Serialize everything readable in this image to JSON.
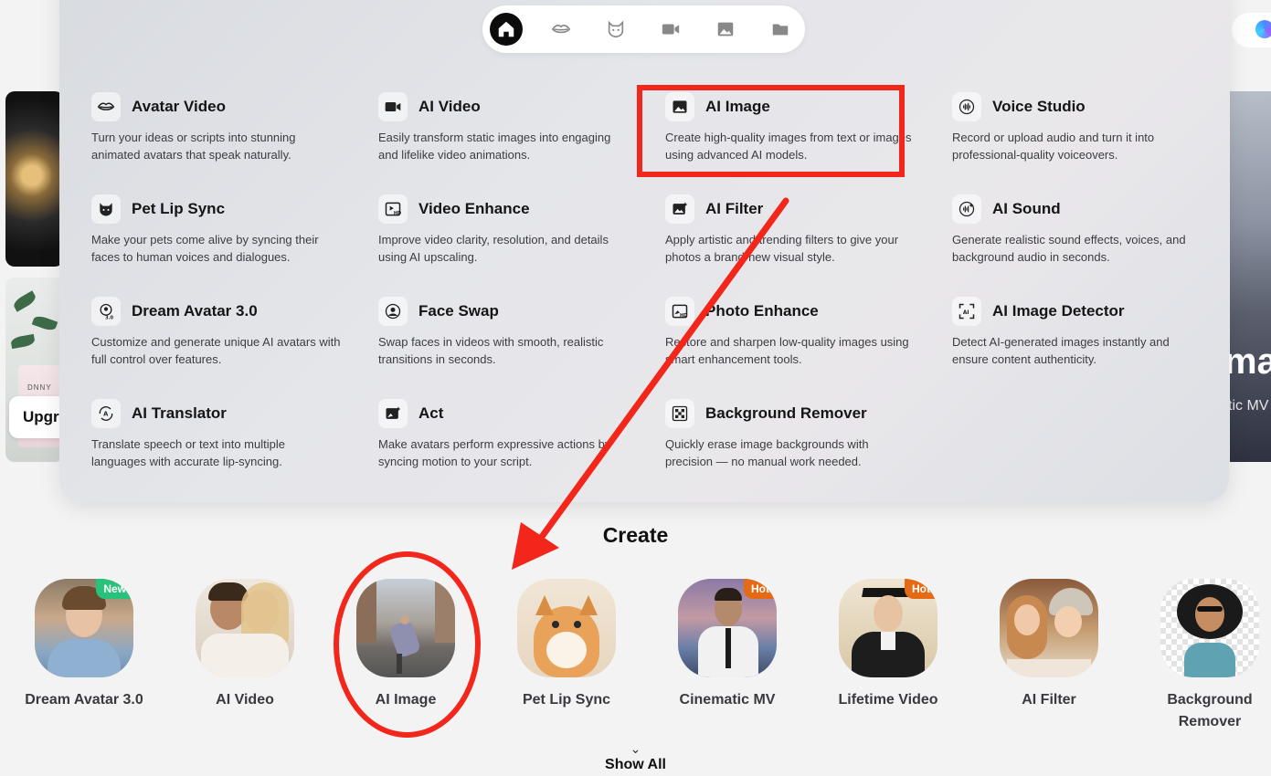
{
  "background": {
    "upgrade_label": "Upgr",
    "bottle_label": "DNNY",
    "right_title": "ma",
    "right_subtitle": "tic MV"
  },
  "nav_tabs": [
    {
      "icon": "home-icon",
      "active": true
    },
    {
      "icon": "lips-icon",
      "active": false
    },
    {
      "icon": "cat-icon",
      "active": false
    },
    {
      "icon": "video-camera-icon",
      "active": false
    },
    {
      "icon": "image-icon",
      "active": false
    },
    {
      "icon": "folder-icon",
      "active": false
    }
  ],
  "menu": [
    {
      "title": "Avatar Video",
      "desc": "Turn your ideas or scripts into stunning animated avatars that speak naturally.",
      "icon": "lips-icon"
    },
    {
      "title": "AI Video",
      "desc": "Easily transform static images into engaging and lifelike video animations.",
      "icon": "video-camera-icon"
    },
    {
      "title": "AI Image",
      "desc": "Create high-quality images from text or images using advanced AI models.",
      "icon": "image-icon"
    },
    {
      "title": "Voice Studio",
      "desc": "Record or upload audio and turn it into professional-quality voiceovers.",
      "icon": "voice-wave-icon"
    },
    {
      "title": "Pet Lip Sync",
      "desc": "Make your pets come alive by syncing their faces to human voices and dialogues.",
      "icon": "cat-icon"
    },
    {
      "title": "Video Enhance",
      "desc": "Improve video clarity, resolution, and details using AI upscaling.",
      "icon": "video-hd-icon"
    },
    {
      "title": "AI Filter",
      "desc": "Apply artistic and trending filters to give your photos a brand-new visual style.",
      "icon": "filter-icon"
    },
    {
      "title": "AI Sound",
      "desc": "Generate realistic sound effects, voices, and background audio in seconds.",
      "icon": "sound-icon"
    },
    {
      "title": "Dream Avatar 3.0",
      "desc": "Customize and generate unique AI avatars with full control over features.",
      "icon": "dream-avatar-icon"
    },
    {
      "title": "Face Swap",
      "desc": "Swap faces in videos with smooth, realistic transitions in seconds.",
      "icon": "face-swap-icon"
    },
    {
      "title": "Photo Enhance",
      "desc": "Restore and sharpen low-quality images using smart enhancement tools.",
      "icon": "photo-hd-icon"
    },
    {
      "title": "AI Image Detector",
      "desc": "Detect AI-generated images instantly and ensure content authenticity.",
      "icon": "ai-detector-icon"
    },
    {
      "title": "AI Translator",
      "desc": "Translate speech or text into multiple languages with accurate lip-syncing.",
      "icon": "translate-icon"
    },
    {
      "title": "Act",
      "desc": "Make avatars perform expressive actions by syncing motion to your script.",
      "icon": "act-icon"
    },
    {
      "title": "Background Remover",
      "desc": "Quickly erase image backgrounds with precision — no manual work needed.",
      "icon": "background-remover-icon"
    }
  ],
  "create": {
    "title": "Create",
    "items": [
      {
        "label": "Dream Avatar 3.0",
        "badge": "New"
      },
      {
        "label": "AI Video",
        "badge": ""
      },
      {
        "label": "AI Image",
        "badge": ""
      },
      {
        "label": "Pet Lip Sync",
        "badge": ""
      },
      {
        "label": "Cinematic MV",
        "badge": "Hot"
      },
      {
        "label": "Lifetime Video",
        "badge": "Hot"
      },
      {
        "label": "AI Filter",
        "badge": ""
      },
      {
        "label": "Background Remover",
        "badge": ""
      }
    ],
    "show_all": "Show All"
  },
  "colors": {
    "annotation_red": "#f2261a",
    "badge_new": "#28c27a",
    "badge_hot": "#e56a16"
  }
}
